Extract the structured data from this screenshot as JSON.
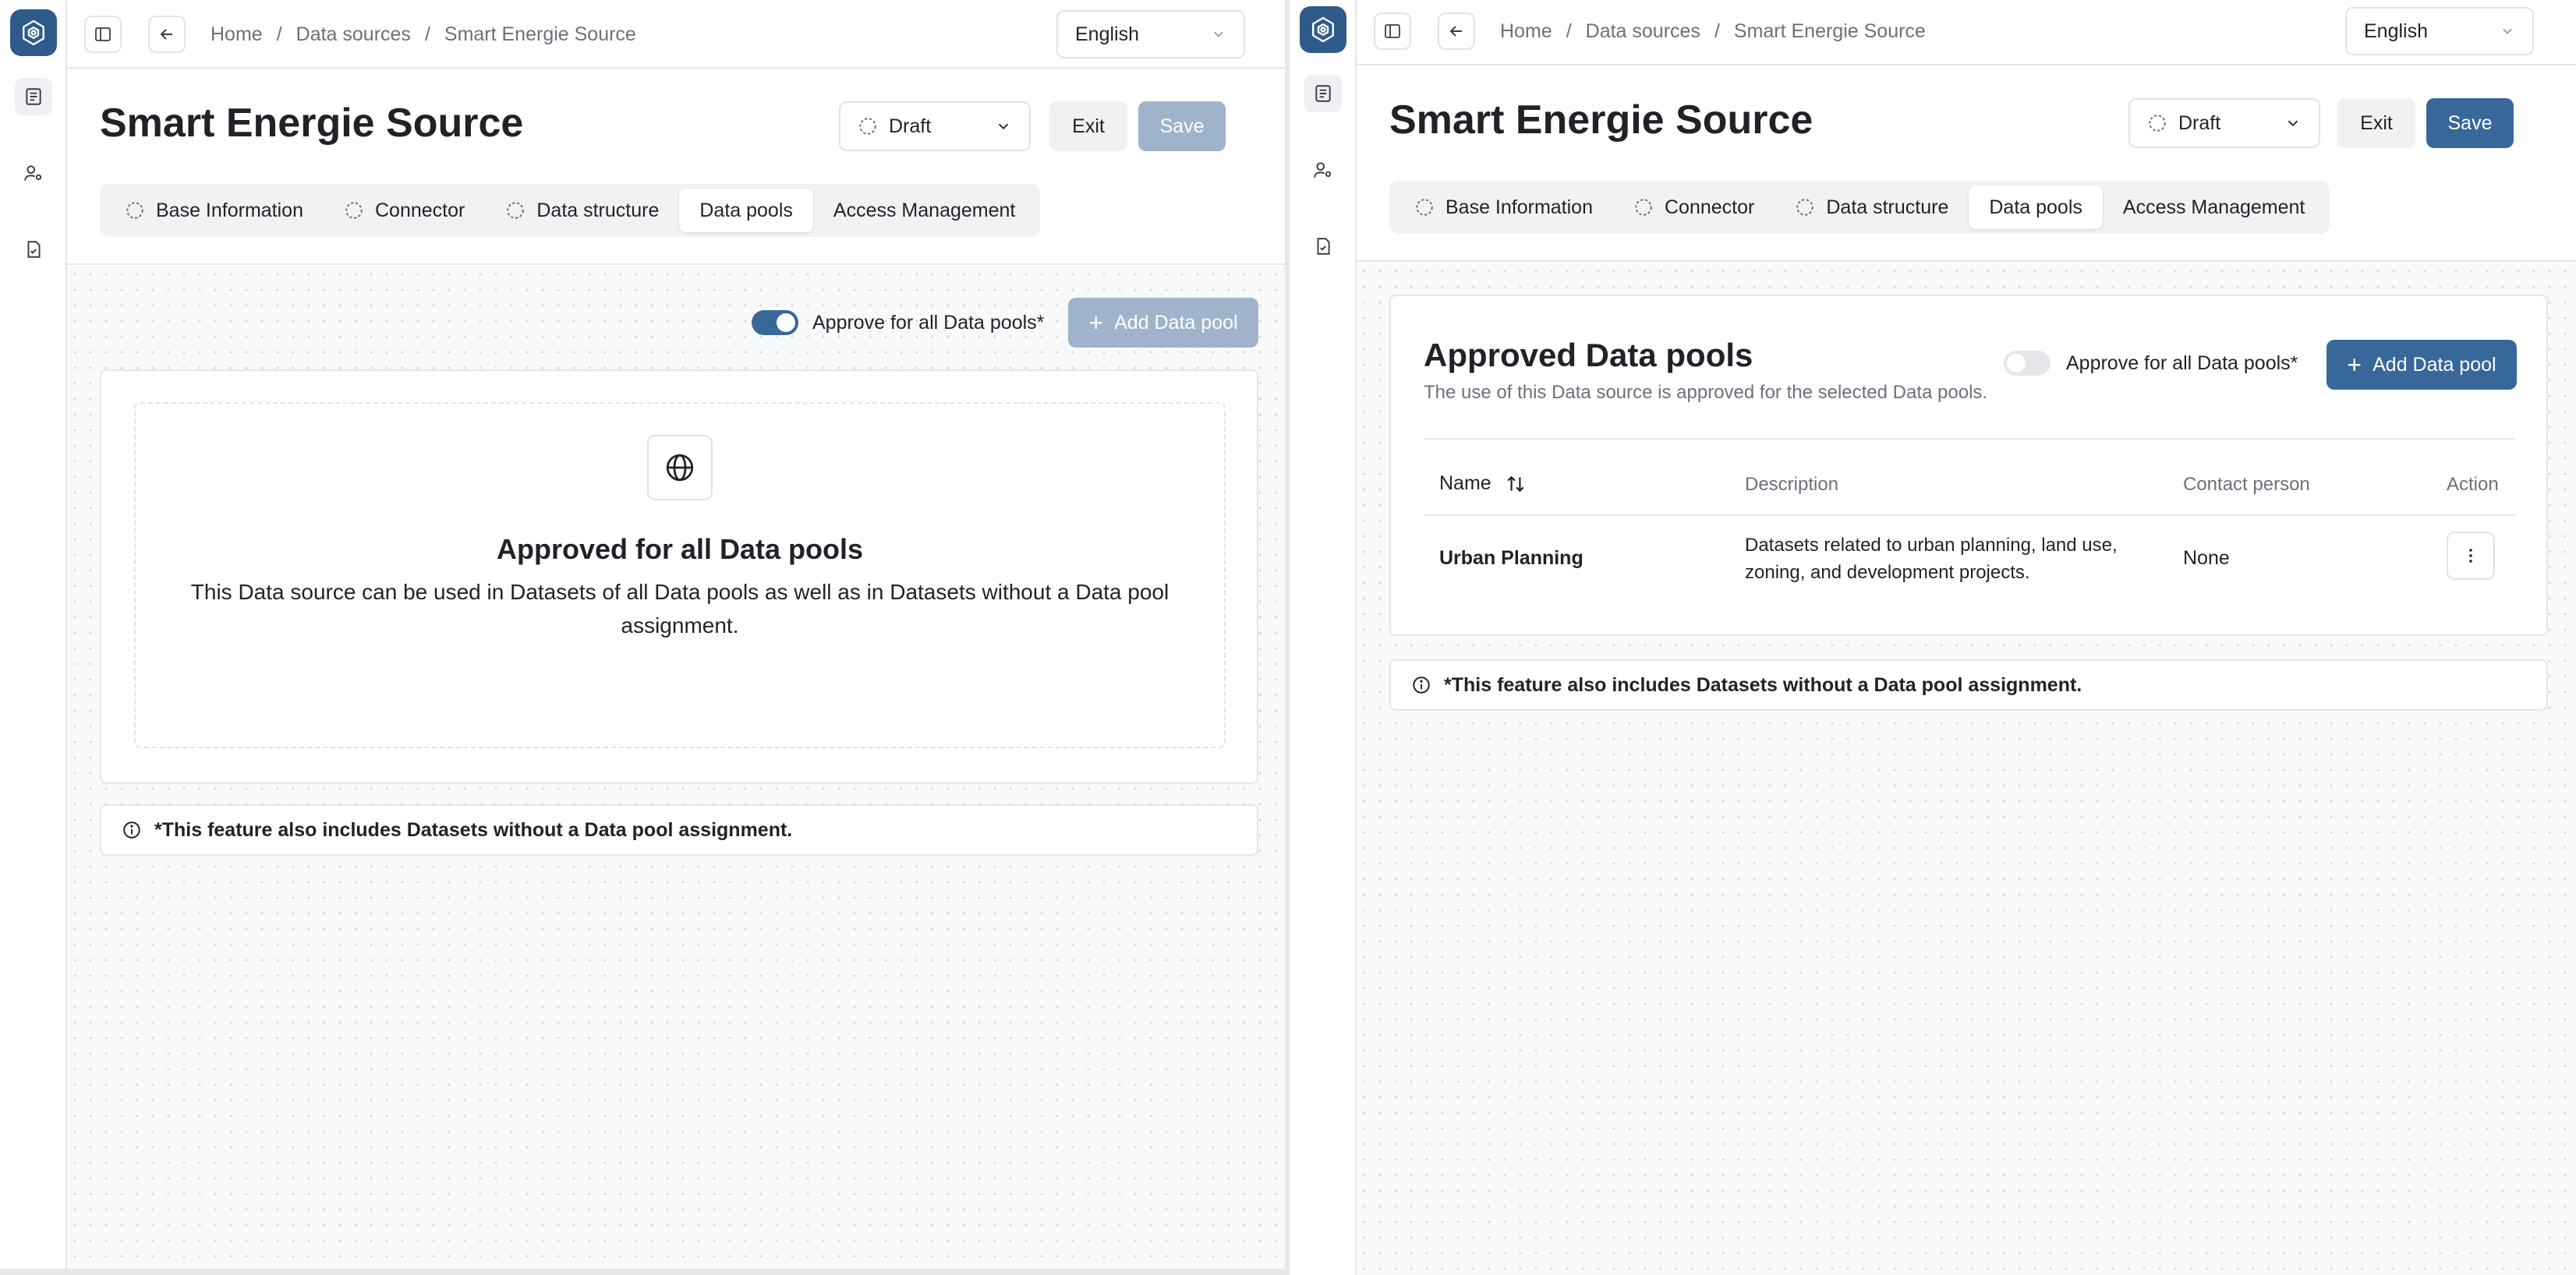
{
  "app": {
    "breadcrumb": [
      "Home",
      "Data sources",
      "Smart Energie Source"
    ],
    "language": "English",
    "page_title": "Smart Energie Source",
    "status": "Draft",
    "exit_label": "Exit",
    "save_label": "Save",
    "tabs": [
      "Base Information",
      "Connector",
      "Data structure",
      "Data pools",
      "Access Management"
    ],
    "active_tab": "Data pools"
  },
  "left_view": {
    "approve_all_toggle": {
      "label": "Approve for all Data pools*",
      "state": "on"
    },
    "add_button": "Add Data pool",
    "add_button_state": "disabled",
    "save_state": "disabled",
    "empty_state": {
      "title": "Approved for all Data pools",
      "text": "This Data source can be used in Datasets of all Data pools as well as in Datasets without a Data pool assignment."
    },
    "note": "*This feature also includes Datasets without a Data pool assignment."
  },
  "right_view": {
    "section_title": "Approved Data pools",
    "section_subtitle": "The use of this Data source is approved for the selected Data pools.",
    "approve_all_toggle": {
      "label": "Approve for all Data pools*",
      "state": "off"
    },
    "add_button": "Add Data pool",
    "add_button_state": "enabled",
    "save_state": "enabled",
    "table": {
      "columns": [
        "Name",
        "Description",
        "Contact person",
        "Action"
      ],
      "rows": [
        {
          "name": "Urban Planning",
          "description": "Datasets related to urban planning, land use, zoning, and development projects.",
          "contact": "None"
        }
      ]
    },
    "note": "*This feature also includes Datasets without a Data pool assignment."
  },
  "colors": {
    "primary": "#38679a",
    "primary_disabled": "#9fb3cb",
    "logo": "#2f5b8a",
    "border": "#e4e6e9",
    "muted_text": "#6b717b"
  },
  "icons": {
    "logo": "hexagon-logo-icon",
    "rail": [
      "document-list-icon",
      "user-settings-icon",
      "file-check-icon"
    ],
    "sidebar_toggle": "sidebar-toggle-icon",
    "back": "arrow-left-icon",
    "dropdown": "chevron-down-icon",
    "status": "dashed-circle-icon",
    "globe": "globe-icon",
    "info": "info-circle-icon",
    "sort": "sort-arrows-icon",
    "more": "more-vertical-icon"
  }
}
